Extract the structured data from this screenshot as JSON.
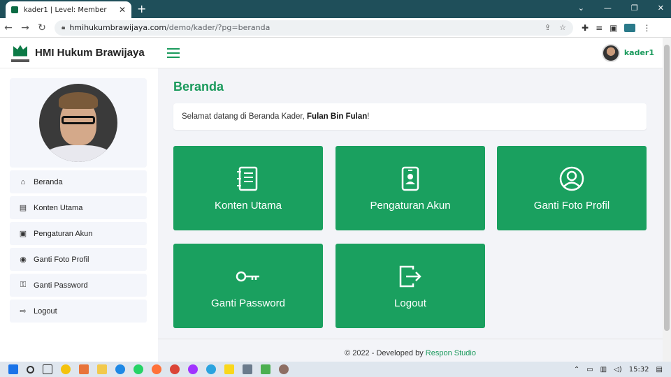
{
  "browser": {
    "tab_title": "kader1 | Level: Member",
    "url_host": "hmihukumbrawijaya.com",
    "url_path": "/demo/kader/?pg=beranda"
  },
  "header": {
    "brand": "HMI Hukum Brawijaya",
    "username": "kader1"
  },
  "sidebar": {
    "items": [
      {
        "label": "Beranda",
        "icon": "home-icon"
      },
      {
        "label": "Konten Utama",
        "icon": "document-icon"
      },
      {
        "label": "Pengaturan Akun",
        "icon": "id-card-icon"
      },
      {
        "label": "Ganti Foto Profil",
        "icon": "user-circle-icon"
      },
      {
        "label": "Ganti Password",
        "icon": "key-icon"
      },
      {
        "label": "Logout",
        "icon": "logout-icon"
      }
    ]
  },
  "main": {
    "title": "Beranda",
    "welcome_prefix": "Selamat datang di Beranda Kader, ",
    "welcome_name": "Fulan Bin Fulan",
    "welcome_suffix": "!",
    "cards": [
      {
        "label": "Konten Utama",
        "icon": "document-icon"
      },
      {
        "label": "Pengaturan Akun",
        "icon": "id-card-icon"
      },
      {
        "label": "Ganti Foto Profil",
        "icon": "user-circle-icon"
      },
      {
        "label": "Ganti Password",
        "icon": "key-icon"
      },
      {
        "label": "Logout",
        "icon": "logout-icon"
      }
    ]
  },
  "footer": {
    "text": "© 2022 - Developed by ",
    "link": "Respon Studio"
  },
  "taskbar": {
    "time": "15:32"
  },
  "colors": {
    "accent": "#1aa05f",
    "title_green": "#1a9a5c"
  }
}
